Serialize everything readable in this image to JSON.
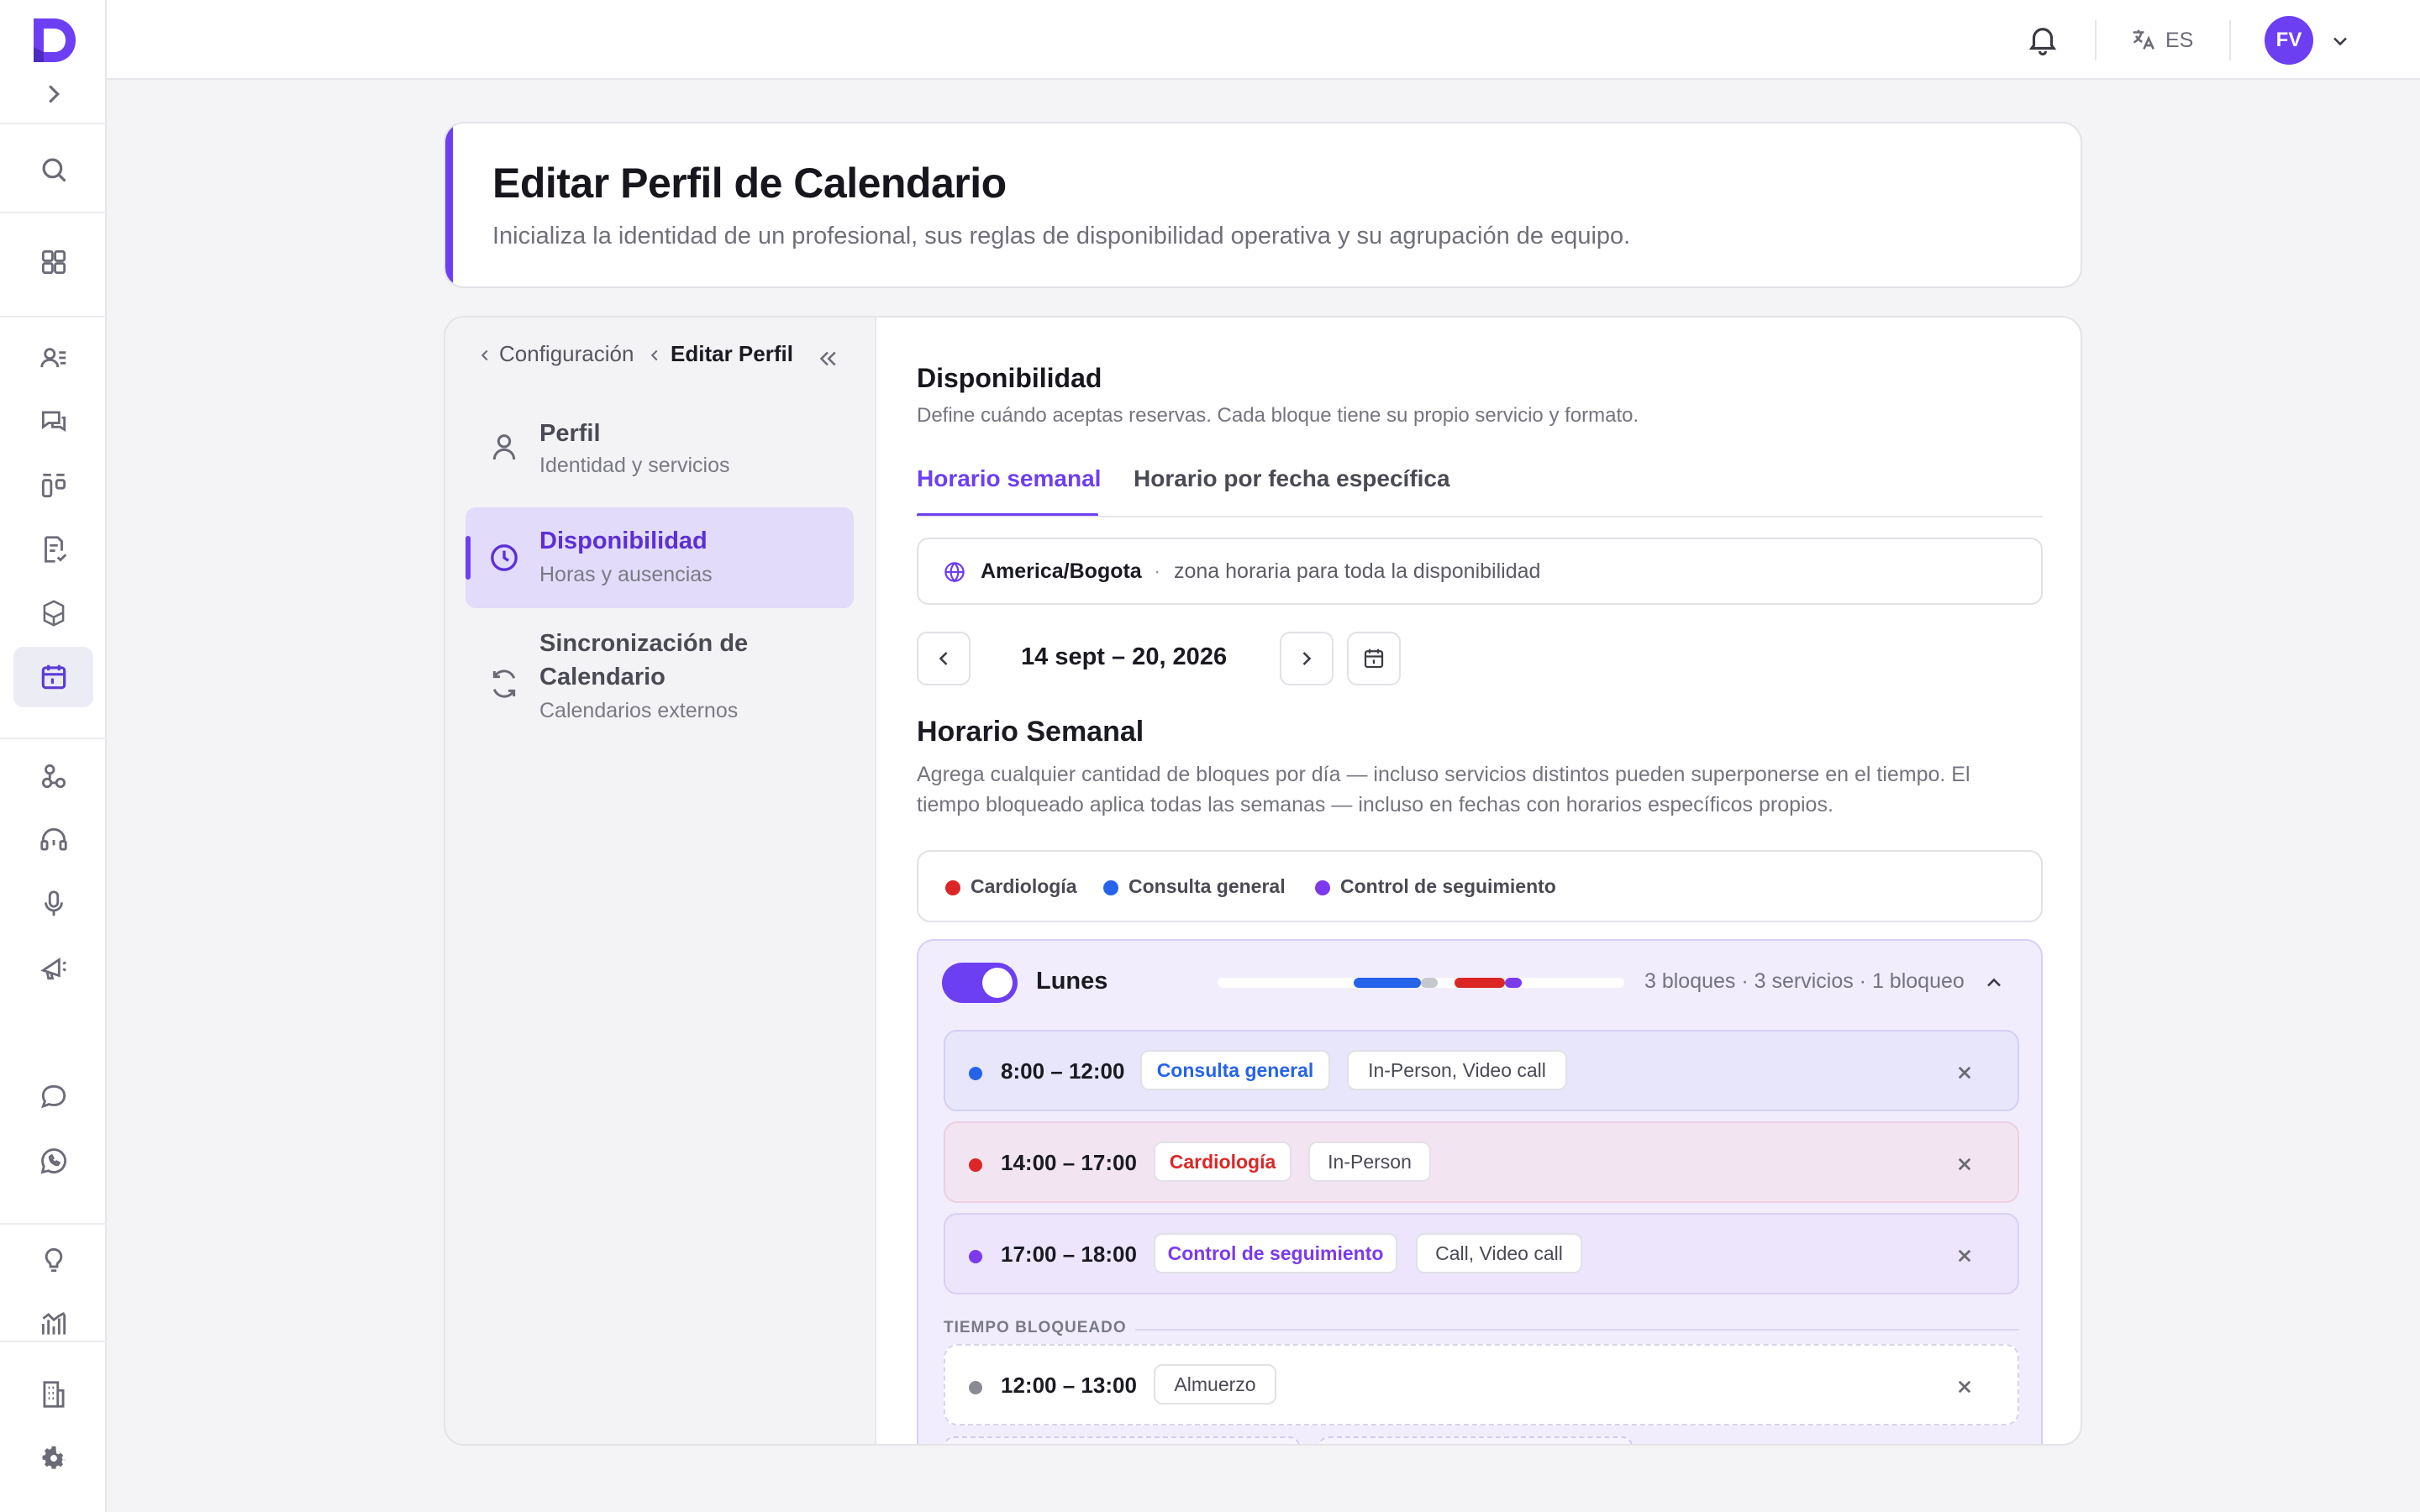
{
  "topbar": {
    "language": "ES",
    "avatar_initials": "FV"
  },
  "header": {
    "title": "Editar Perfil de Calendario",
    "subtitle": "Inicializa la identidad de un profesional, sus reglas de disponibilidad operativa y su agrupación de equipo."
  },
  "breadcrumb": {
    "parent": "Configuración",
    "current": "Editar Perfil"
  },
  "nav": [
    {
      "title": "Perfil",
      "subtitle": "Identidad y servicios",
      "icon": "user-icon"
    },
    {
      "title": "Disponibilidad",
      "subtitle": "Horas y ausencias",
      "icon": "clock-icon"
    },
    {
      "title_line1": "Sincronización de",
      "title_line2": "Calendario",
      "subtitle": "Calendarios externos",
      "icon": "sync-icon"
    }
  ],
  "availability": {
    "title": "Disponibilidad",
    "subtitle": "Define cuándo aceptas reservas. Cada bloque tiene su propio servicio y formato.",
    "tabs": [
      "Horario semanal",
      "Horario por fecha específica"
    ],
    "timezone": "America/Bogota",
    "timezone_note": "zona horaria para toda la disponibilidad",
    "week_range": "14 sept – 20, 2026",
    "weekly_title": "Horario Semanal",
    "weekly_desc_line1": "Agrega cualquier cantidad de bloques por día — incluso servicios distintos pueden superponerse en el tiempo. El",
    "weekly_desc_line2": "tiempo bloqueado aplica todas las semanas — incluso en fechas con horarios específicos propios.",
    "legend": [
      {
        "label": "Cardiología",
        "color": "#dc2626"
      },
      {
        "label": "Consulta general",
        "color": "#2563eb"
      },
      {
        "label": "Control de seguimiento",
        "color": "#7c3aed"
      }
    ],
    "day": {
      "name": "Lunes",
      "enabled": true,
      "summary": "3 bloques · 3 servicios · 1 bloqueo",
      "slots": [
        {
          "time": "8:00 – 12:00",
          "service": "Consulta general",
          "format": "In-Person, Video call",
          "color": "#2563eb"
        },
        {
          "time": "14:00 – 17:00",
          "service": "Cardiología",
          "format": "In-Person",
          "color": "#dc2626"
        },
        {
          "time": "17:00 – 18:00",
          "service": "Control de seguimiento",
          "format": "Call, Video call",
          "color": "#7c3aed"
        }
      ],
      "blocked_label": "TIEMPO BLOQUEADO",
      "blocked": [
        {
          "time": "12:00 – 13:00",
          "label": "Almuerzo"
        }
      ]
    }
  },
  "colors": {
    "accent": "#6d3ff2",
    "active_nav_bg": "#e2dbfa"
  }
}
